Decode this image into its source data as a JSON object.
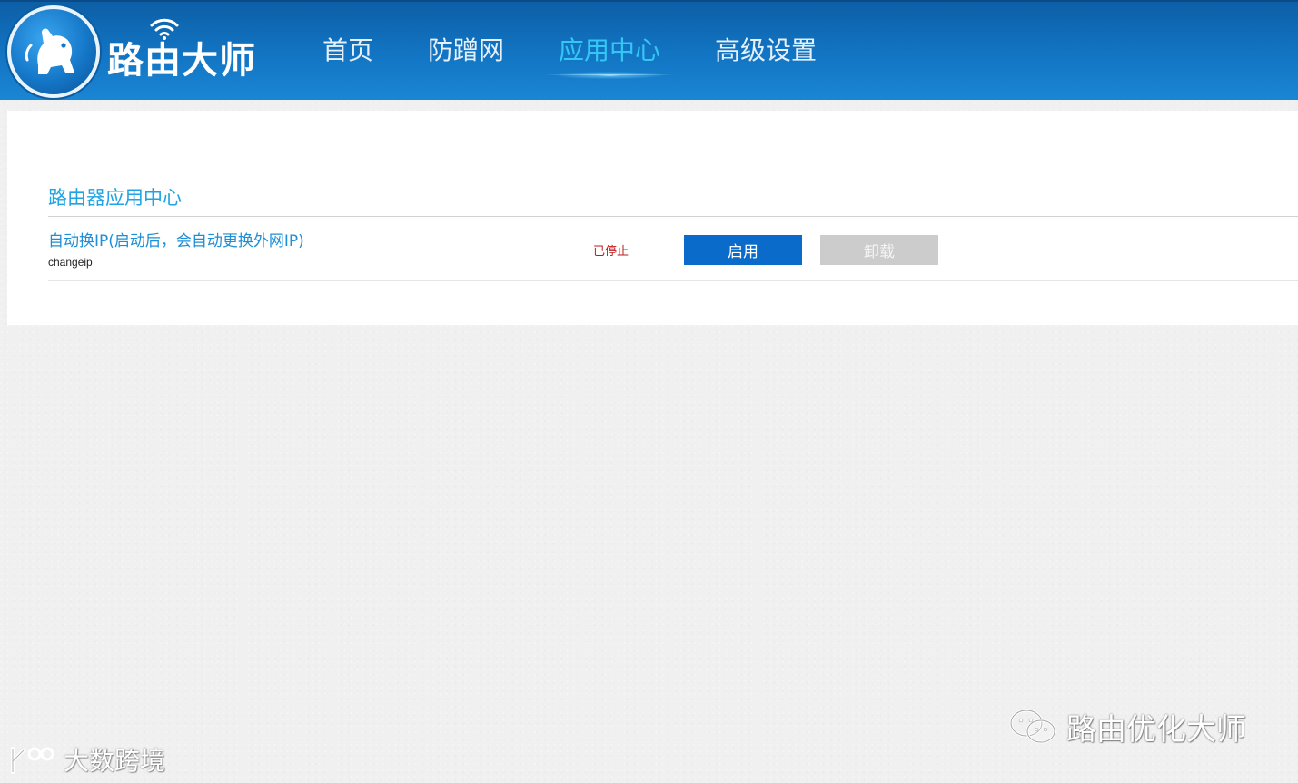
{
  "header": {
    "logo_text": "路由大师",
    "nav": [
      {
        "label": "首页",
        "active": false
      },
      {
        "label": "防蹭网",
        "active": false
      },
      {
        "label": "应用中心",
        "active": true
      },
      {
        "label": "高级设置",
        "active": false
      }
    ]
  },
  "main": {
    "title": "路由器应用中心",
    "apps": [
      {
        "name": "自动换IP(启动后，会自动更换外网IP)",
        "id": "changeip",
        "status": "已停止",
        "enable_label": "启用",
        "uninstall_label": "卸载"
      }
    ]
  },
  "watermarks": {
    "right": "路由优化大师",
    "left": "大数跨境"
  },
  "colors": {
    "header_blue": "#1275c4",
    "accent_cyan": "#35c6f4",
    "title_blue": "#1fa3e4",
    "enable_button": "#0a6bcb",
    "uninstall_button": "#cccccc",
    "status_red": "#c01818"
  },
  "icons": {
    "logo": "dog-logo-icon",
    "wifi": "wifi-icon",
    "wechat": "wechat-icon",
    "brand": "brand-icon"
  }
}
